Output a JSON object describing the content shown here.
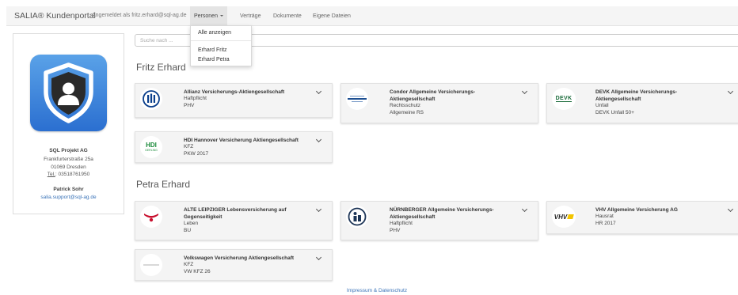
{
  "navbar": {
    "brand": "SALIA® Kundenportal",
    "logged_in": "Angemeldet als fritz.erhard@sql-ag.de",
    "links": {
      "personen": "Personen",
      "vertraege": "Verträge",
      "dokumente": "Dokumente",
      "eigene_dateien": "Eigene Dateien"
    }
  },
  "dropdown": {
    "show_all": "Alle anzeigen",
    "items": [
      "Erhard Fritz",
      "Erhard Petra"
    ]
  },
  "contact": {
    "company": "SQL Projekt AG",
    "street": "Frankfurterstraße 25a",
    "city": "01069 Dresden",
    "tel_label": "Tel.",
    "tel_number": ": 03518761950",
    "name": "Patrick Sohr",
    "email": "salia.support@sql-ag.de"
  },
  "search": {
    "placeholder": "Suche nach ..."
  },
  "sections": [
    {
      "person": "Fritz Erhard",
      "cards": [
        {
          "title": "Allianz Versicherungs-Aktiengesellschaft",
          "lines": [
            "Haftpflicht",
            "PHV"
          ],
          "logo": "allianz-logo"
        },
        {
          "title": "Condor Allgemeine Versicherungs-Aktiengesellschaft",
          "lines": [
            "Rechtsschutz",
            "Allgemeine RS"
          ],
          "logo": "condor-logo"
        },
        {
          "title": "DEVK Allgemeine Versicherungs-Aktiengesellschaft",
          "lines": [
            "Unfall",
            "DEVK Unfall 50+"
          ],
          "logo": "devk-logo",
          "logo_text": "DEVK"
        },
        {
          "title": "HDI Hannover Versicherung Aktiengesellschaft",
          "lines": [
            "KFZ",
            "PKW 2017"
          ],
          "logo": "hdi-logo",
          "logo_text": "HDI",
          "logo_sub": "GERLING"
        }
      ]
    },
    {
      "person": "Petra Erhard",
      "cards": [
        {
          "title": "ALTE LEIPZIGER Lebensversicherung auf Gegenseitigkeit",
          "lines": [
            "Leben",
            "BU"
          ],
          "logo": "alte-leipziger-logo"
        },
        {
          "title": "NÜRNBERGER Allgemeine Versicherungs-Aktiengesellschaft",
          "lines": [
            "Haftpflicht",
            "PHV"
          ],
          "logo": "nuernberger-logo"
        },
        {
          "title": "VHV Allgemeine Versicherung AG",
          "lines": [
            "Hausrat",
            "HR 2017"
          ],
          "logo": "vhv-logo",
          "logo_text": "VHV"
        },
        {
          "title": "Volkswagen Versicherung Aktiengesellschaft",
          "lines": [
            "KFZ",
            "VW KFZ 26"
          ],
          "logo": "volkswagen-logo"
        }
      ]
    }
  ],
  "footer": {
    "link": "Impressum & Datenschutz"
  },
  "colors": {
    "link": "#3a73b8",
    "logo_blue": "#2b6fd0",
    "navbar": "#f5f5f5",
    "card": "#f4f4f4"
  }
}
